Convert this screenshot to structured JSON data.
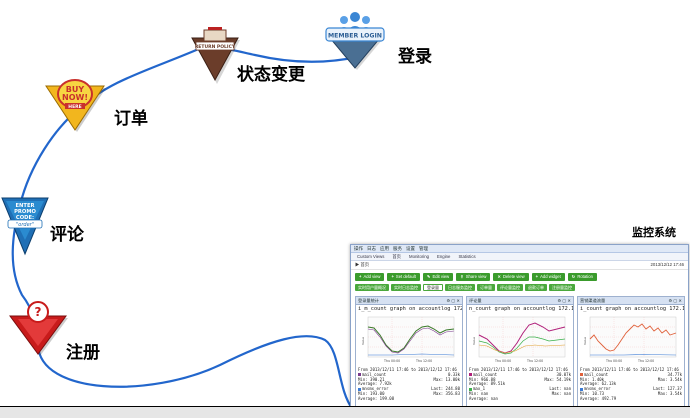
{
  "steps": [
    {
      "label": "注册",
      "badge_text": "?",
      "badge_caption": ""
    },
    {
      "label": "评论",
      "badge_text": "ENTER PROMO CODE:",
      "badge_caption": "\"order\""
    },
    {
      "label": "订单",
      "badge_text": "BUY NOW!",
      "badge_caption": "HERE"
    },
    {
      "label": "状态变更",
      "badge_text": "RETURN POLICY",
      "badge_caption": ""
    },
    {
      "label": "登录",
      "badge_text": "MEMBER LOGIN",
      "badge_caption": ""
    }
  ],
  "monitor": {
    "title": "监控系统",
    "menu": [
      "操作",
      "日志",
      "应用",
      "服务",
      "设置",
      "管理"
    ],
    "tabs": [
      "Custom Views",
      "首页",
      "Monitoring",
      "Engine",
      "Statistics"
    ],
    "url_left": "▶ 首页",
    "url_right": "2013/12/12 17:46",
    "buttons": [
      "Add view",
      "Set default",
      "Edit view",
      "Share view",
      "Delete view",
      "Add widget",
      "Rotation"
    ],
    "sub_tabs": [
      "实时用户量概况",
      "实时日志监控",
      "登录量",
      "日志服务监控",
      "订单量",
      "评论量监控",
      "退款订单",
      "注册量监控"
    ],
    "sub_tab_active": 2,
    "panels": [
      {
        "title": "登录量统计",
        "graph_title": "i_m_count graph on accountlog 172.17.33",
        "time_range": "From 2013/12/11 17:46 to 2013/12/12 17:46",
        "x_ticks": [
          "Thu 00:00",
          "Thu 12:00"
        ],
        "legend": [
          {
            "name": "mail_count",
            "last": "0.33k",
            "color": "#7a3a8c"
          },
          {
            "name": "Min: 390.21",
            "last": "Max: 13.00k",
            "color": ""
          },
          {
            "name": "Average: 7.92k",
            "last": "",
            "color": ""
          },
          {
            "name": "mnsmx_error",
            "last": "Last: 244.80",
            "color": "#3a7bd5"
          },
          {
            "name": "Min: 193.00",
            "last": "Max: 356.83",
            "color": ""
          },
          {
            "name": "Average: 199.08",
            "last": "",
            "color": ""
          }
        ]
      },
      {
        "title": "评论量",
        "graph_title": "n_count graph on accountlog 172.17.33",
        "time_range": "From 2013/12/11 17:46 to 2013/12/12 17:46",
        "x_ticks": [
          "Thu 00:00",
          "Thu 12:00"
        ],
        "legend": [
          {
            "name": "mail_count",
            "last": "30.07k",
            "color": "#b0207a"
          },
          {
            "name": "Min: 966.88",
            "last": "Max: 54.19k",
            "color": ""
          },
          {
            "name": "Average: 89.51k",
            "last": "",
            "color": ""
          },
          {
            "name": "max_1",
            "last": "Last: nan",
            "color": "#3ab04a"
          },
          {
            "name": "Min: nan",
            "last": "Max: nan",
            "color": ""
          },
          {
            "name": "Average: nan",
            "last": "",
            "color": ""
          }
        ]
      },
      {
        "title": "营销渠道流量",
        "graph_title": "i_count graph on accountlog 172.17.33",
        "time_range": "From 2013/12/11 17:46 to 2013/12/12 17:46",
        "x_ticks": [
          "Thu 00:00",
          "Thu 12:00"
        ],
        "legend": [
          {
            "name": "mail_count",
            "last": "34.77k",
            "color": "#e0603a"
          },
          {
            "name": "Min: 1.40k",
            "last": "Max: 3.54k",
            "color": ""
          },
          {
            "name": "Average: 62.13k",
            "last": "",
            "color": ""
          },
          {
            "name": "mnsmx_error",
            "last": "Last: 127.37",
            "color": "#3a7bd5"
          },
          {
            "name": "Min: 10.73",
            "last": "Max: 3.54k",
            "color": ""
          },
          {
            "name": "Average: 492.79",
            "last": "",
            "color": ""
          }
        ]
      }
    ]
  },
  "colors": {
    "curve": "#2266cc",
    "red": "#cc2222",
    "green": "#2e8b3a",
    "orange": "#e07030"
  }
}
